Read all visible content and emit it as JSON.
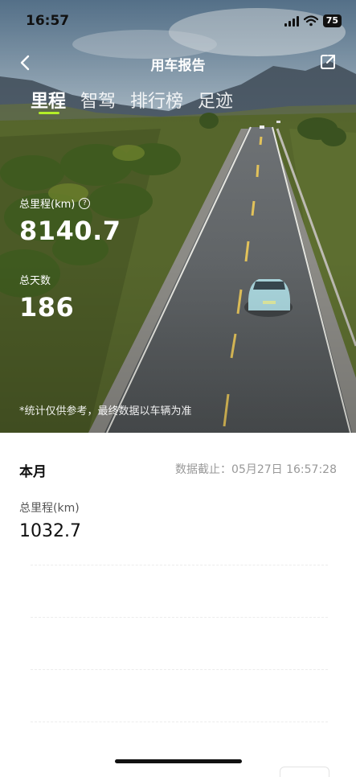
{
  "status": {
    "time": "16:57",
    "battery": "75"
  },
  "nav": {
    "title": "用车报告"
  },
  "tabs": [
    {
      "label": "里程",
      "active": true
    },
    {
      "label": "智驾",
      "active": false
    },
    {
      "label": "排行榜",
      "active": false
    },
    {
      "label": "足迹",
      "active": false
    }
  ],
  "totals": {
    "mileage_label": "总里程(km)",
    "mileage_value": "8140.7",
    "days_label": "总天数",
    "days_value": "186",
    "disclaimer": "*统计仅供参考，最终数据以车辆为准"
  },
  "month": {
    "title": "本月",
    "cutoff": "数据截止：05月27日 16:57:28",
    "mileage_label": "总里程(km)",
    "mileage_value": "1032.7"
  },
  "colors": {
    "tab_indicator": "#b4ee28"
  },
  "icons": [
    "back-arrow-icon",
    "share-icon",
    "help-circle-icon",
    "signal-icon",
    "wifi-icon",
    "battery-icon"
  ]
}
